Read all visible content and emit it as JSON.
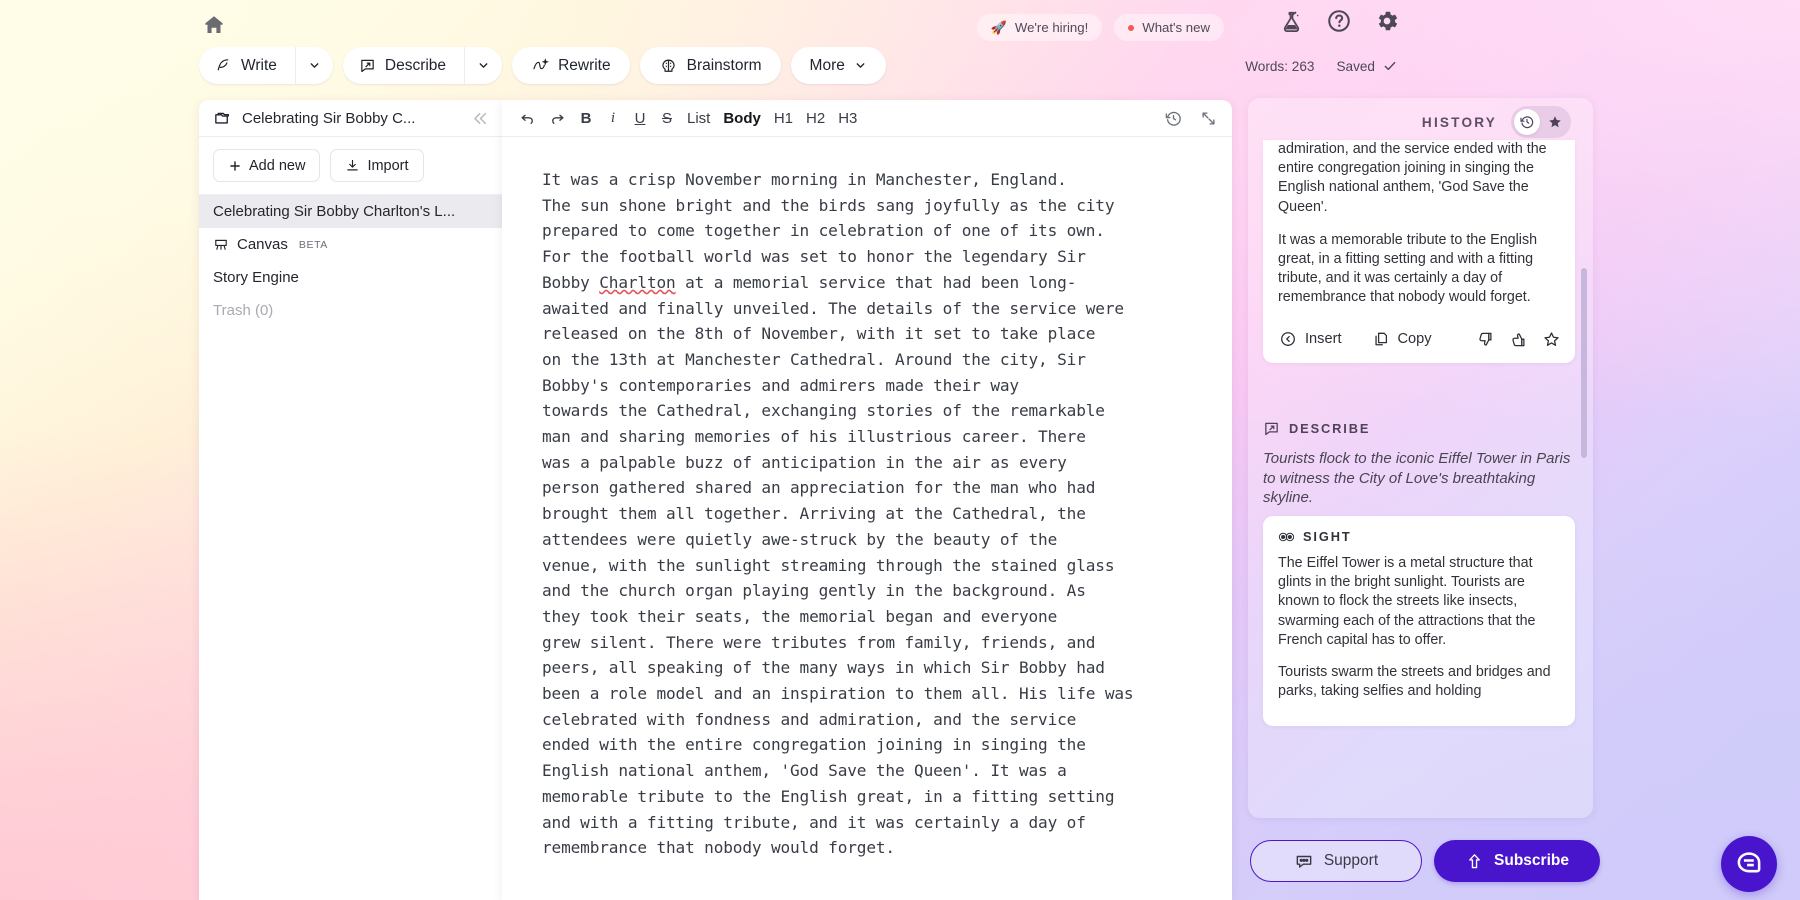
{
  "topbar": {
    "home_label": "Home",
    "tools": [
      {
        "label": "Write",
        "icon": "quill-icon",
        "caret": true
      },
      {
        "label": "Describe",
        "icon": "describe-icon",
        "caret": true
      },
      {
        "label": "Rewrite",
        "icon": "rewrite-icon",
        "caret": false
      },
      {
        "label": "Brainstorm",
        "icon": "brainstorm-icon",
        "caret": false
      },
      {
        "label": "More",
        "icon": "",
        "caret": true
      }
    ],
    "pills": [
      {
        "label": "We're hiring!",
        "icon": "rocket-icon"
      },
      {
        "label": "What's new",
        "icon": "red-dot-icon"
      }
    ],
    "icons": [
      {
        "name": "flask-icon",
        "label": "Experiments"
      },
      {
        "name": "help-icon",
        "label": "Help"
      },
      {
        "name": "gear-icon",
        "label": "Settings"
      }
    ],
    "word_count": "Words: 263",
    "save_status": "Saved"
  },
  "sidebar": {
    "project_title": "Celebrating Sir Bobby C...",
    "collapse_label": "Collapse sidebar",
    "add_new_label": "Add new",
    "import_label": "Import",
    "items": [
      {
        "label": "Celebrating Sir Bobby Charlton's L...",
        "active": true,
        "icon": "",
        "badge": ""
      },
      {
        "label": "Canvas",
        "active": false,
        "icon": "canvas-icon",
        "badge": "BETA"
      },
      {
        "label": "Story Engine",
        "active": false,
        "icon": "",
        "badge": ""
      },
      {
        "label": "Trash (0)",
        "active": false,
        "icon": "",
        "badge": "",
        "muted": true
      }
    ]
  },
  "editor": {
    "toolbar": {
      "undo": "undo-icon",
      "redo": "redo-icon",
      "bold": "B",
      "italic": "i",
      "underline": "U",
      "strike": "S",
      "list": "List",
      "body": "Body",
      "h1": "H1",
      "h2": "H2",
      "h3": "H3",
      "history": "history-icon",
      "expand": "expand-icon"
    },
    "document": {
      "part1": "It was a crisp November morning in Manchester, England.\nThe sun shone bright and the birds sang joyfully as the city\nprepared to come together in celebration of one of its own.\nFor the football world was set to honor the legendary Sir\nBobby ",
      "misspelled": "Charlton",
      "part2": " at a memorial service that had been long-\nawaited and finally unveiled. The details of the service were\nreleased on the 8th of November, with it set to take place\non the 13th at Manchester Cathedral. Around the city, Sir\nBobby's contemporaries and admirers made their way\ntowards the Cathedral, exchanging stories of the remarkable\nman and sharing memories of his illustrious career. There\nwas a palpable buzz of anticipation in the air as every\nperson gathered shared an appreciation for the man who had\nbrought them all together. Arriving at the Cathedral, the\nattendees were quietly awe-struck by the beauty of the\nvenue, with the sunlight streaming through the stained glass\nand the church organ playing gently in the background. As\nthey took their seats, the memorial began and everyone\ngrew silent. There were tributes from family, friends, and\npeers, all speaking of the many ways in which Sir Bobby had\nbeen a role model and an inspiration to them all. His life was\ncelebrated with fondness and admiration, and the service\nended with the entire congregation joining in singing the\nEnglish national anthem, 'God Save the Queen'. It was a\nmemorable tribute to the English great, in a fitting setting\nand with a fitting tribute, and it was certainly a day of\nremembrance that nobody would forget."
    }
  },
  "right_panel": {
    "title": "HISTORY",
    "toggle": [
      {
        "name": "history-icon",
        "active": true
      },
      {
        "name": "star-icon",
        "active": false
      }
    ],
    "history_card": {
      "paragraphs": [
        "admiration, and the service ended with the entire congregation joining in singing the English national anthem, 'God Save the Queen'.",
        "It was a memorable tribute to the English great, in a fitting setting and with a fitting tribute, and it was certainly a day of remembrance that nobody would forget."
      ],
      "actions": [
        {
          "label": "Insert",
          "icon": "insert-icon"
        },
        {
          "label": "Copy",
          "icon": "copy-icon"
        }
      ],
      "icon_actions": [
        {
          "name": "thumbs-down-icon"
        },
        {
          "name": "thumbs-up-icon"
        },
        {
          "name": "star-outline-icon"
        }
      ]
    },
    "describe": {
      "title": "DESCRIBE",
      "icon": "describe-icon",
      "prompt": "Tourists flock to the iconic Eiffel Tower in Paris to witness the City of Love's breathtaking skyline."
    },
    "sight": {
      "title": "SIGHT",
      "icon": "eyes-icon",
      "paragraphs": [
        "The Eiffel Tower is a metal structure that glints in the bright sunlight. Tourists are known to flock the streets like insects, swarming each of the attractions that the French capital has to offer.",
        "Tourists swarm the streets and bridges and parks, taking selfies and holding"
      ]
    }
  },
  "footer": {
    "support_label": "Support",
    "support_icon": "chat-dots-icon",
    "subscribe_label": "Subscribe",
    "subscribe_icon": "arrow-up-icon",
    "chat_widget_icon": "chat-bubble-icon"
  },
  "colors": {
    "accent_purple": "#4915cc",
    "misspell_red": "#e0565a",
    "active_row": "#ebebef"
  }
}
